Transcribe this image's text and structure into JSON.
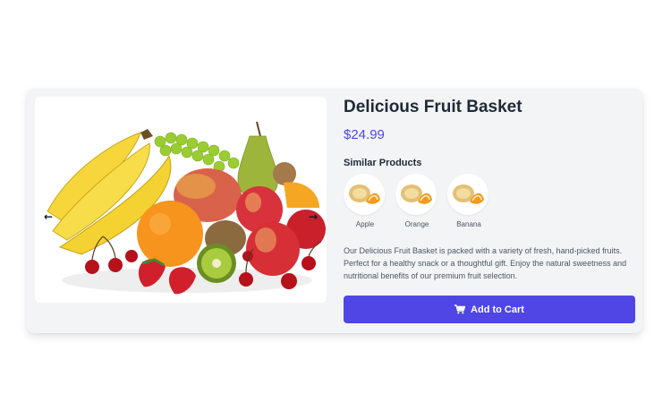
{
  "product": {
    "name": "Delicious Fruit Basket",
    "price": "$24.99",
    "description": "Our Delicious Fruit Basket is packed with a variety of fresh, hand-picked fruits. Perfect for a healthy snack or a thoughtful gift. Enjoy the natural sweetness and nutritional benefits of our premium fruit selection."
  },
  "gallery": {
    "prev_icon": "←",
    "next_icon": "→"
  },
  "similar": {
    "heading": "Similar Products",
    "items": [
      {
        "label": "Apple",
        "icon": "melon-slice-icon"
      },
      {
        "label": "Orange",
        "icon": "melon-slice-icon"
      },
      {
        "label": "Banana",
        "icon": "melon-slice-icon"
      }
    ]
  },
  "cart": {
    "label": "Add to Cart",
    "icon": "cart-icon"
  },
  "colors": {
    "accent": "#4f46e5",
    "card_background": "#f3f4f6",
    "title_text": "#1f2937",
    "body_text": "#4b5563"
  }
}
